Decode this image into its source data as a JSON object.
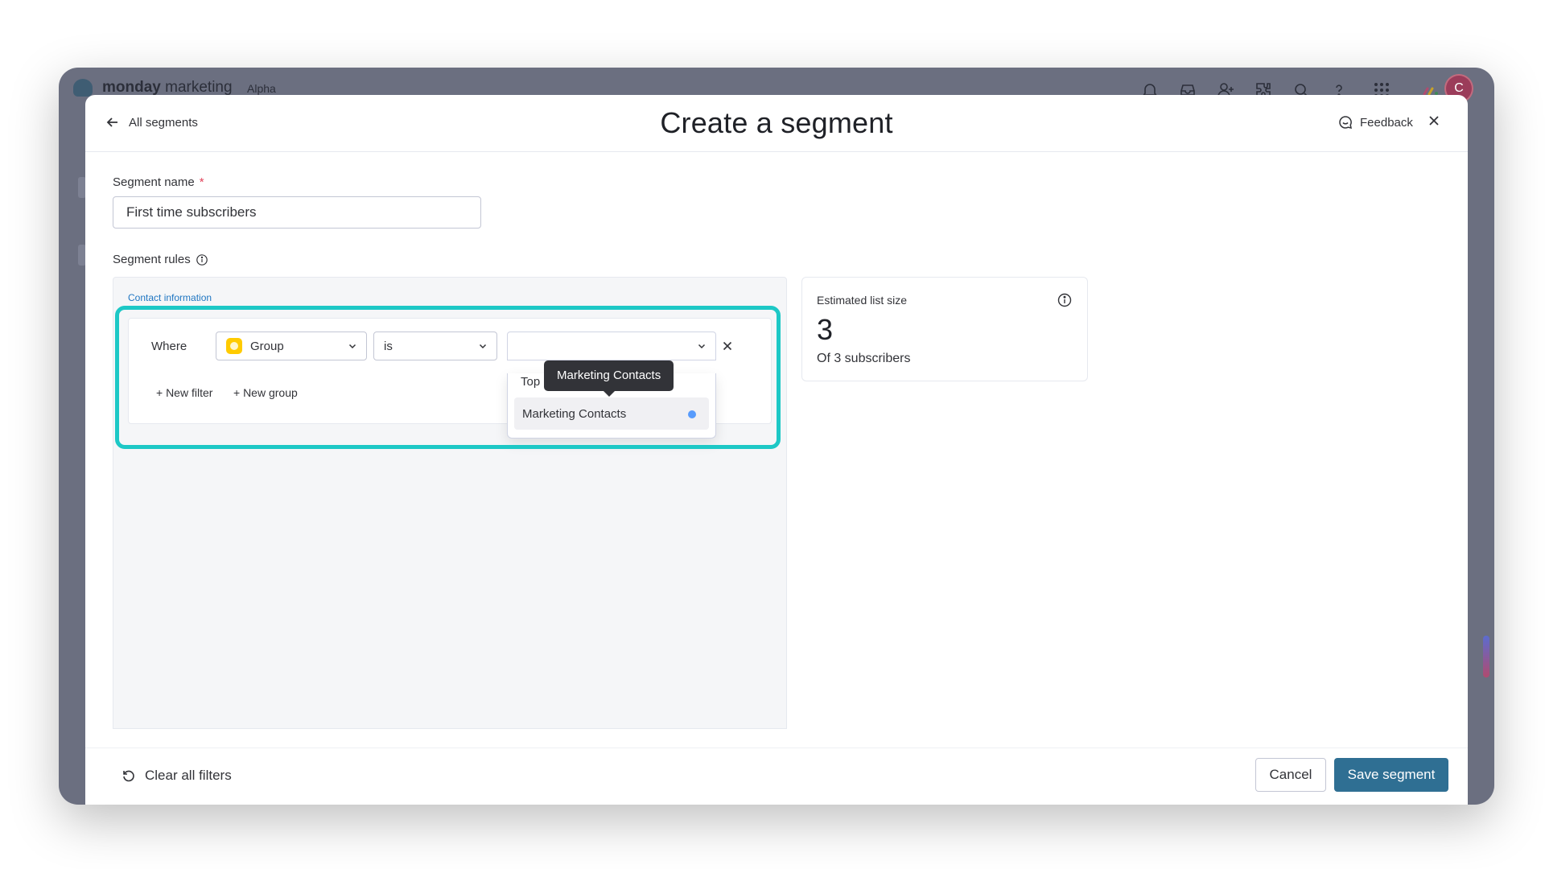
{
  "app": {
    "brand_bold": "monday",
    "brand_light": "marketing",
    "badge": "Alpha",
    "avatar_initial": "C",
    "icons": [
      "bell-icon",
      "inbox-icon",
      "invite-user-icon",
      "integrations-icon",
      "search-icon",
      "help-icon",
      "apps-grid-icon",
      "monday-logo-icon"
    ]
  },
  "header": {
    "back_label": "All segments",
    "title": "Create a segment",
    "feedback_label": "Feedback"
  },
  "form": {
    "name_label": "Segment name",
    "required_mark": "*",
    "name_value": "First time subscribers",
    "rules_label": "Segment rules"
  },
  "rules": {
    "section_tag": "Contact information",
    "where_label": "Where",
    "field_select": "Group",
    "operator_select": "is",
    "value_select": "",
    "new_filter": "+ New filter",
    "new_group": "+ New group"
  },
  "dropdown": {
    "category": "Top",
    "option": "Marketing Contacts",
    "tooltip": "Marketing Contacts"
  },
  "estimate": {
    "title": "Estimated list size",
    "count": "3",
    "subtitle": "Of 3 subscribers"
  },
  "footer": {
    "clear_label": "Clear all filters",
    "cancel_label": "Cancel",
    "save_label": "Save segment"
  },
  "colors": {
    "accent_highlight": "#1dc8c6",
    "primary_button": "#2f6f93",
    "required": "#e2445c",
    "selected_dot": "#579bfc",
    "group_icon": "#ffcb00"
  }
}
